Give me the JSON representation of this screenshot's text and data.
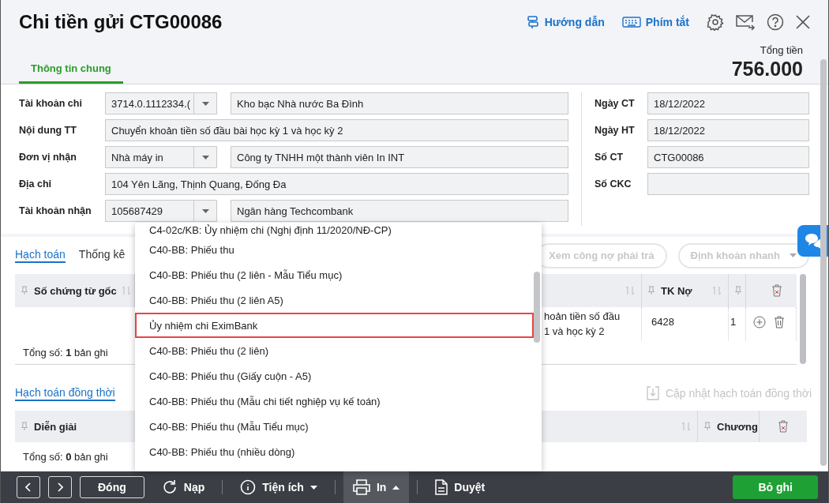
{
  "window": {
    "title": "Chi tiền gửi CTG00086"
  },
  "header_links": [
    {
      "kind": "guide",
      "label": "Hướng dẫn"
    },
    {
      "kind": "shortcut",
      "label": "Phím tắt"
    }
  ],
  "total": {
    "label": "Tổng tiền",
    "value": "756.000"
  },
  "tabs": [
    {
      "label": "Thông tin chung",
      "selected": true
    }
  ],
  "form_left": [
    {
      "label": "Tài khoản chi",
      "kind": "combo",
      "value": "3714.0.1112334.(",
      "extra": "Kho bạc Nhà nước Ba Đình"
    },
    {
      "label": "Nội dung TT",
      "kind": "text",
      "value": "Chuyển khoản tiền số đầu bài học kỳ 1 và học kỳ 2"
    },
    {
      "label": "Đơn vị nhận",
      "kind": "combo",
      "value": "Nhà máy in",
      "extra": "Công ty TNHH một thành viên In INT"
    },
    {
      "label": "Địa chỉ",
      "kind": "text",
      "value": "104 Yên Lãng, Thịnh Quang, Đống Đa"
    },
    {
      "label": "Tài khoản nhận",
      "kind": "combo",
      "value": "105687429",
      "extra": "Ngân hàng Techcombank"
    }
  ],
  "form_right": [
    {
      "label": "Ngày CT",
      "value": "18/12/2022"
    },
    {
      "label": "Ngày HT",
      "value": "18/12/2022"
    },
    {
      "label": "Số CT",
      "value": "CTG00086"
    },
    {
      "label": "Số CKC"
    }
  ],
  "detail_tabs": [
    {
      "label": "Hạch toán",
      "selected": true
    },
    {
      "label": "Thống kê",
      "selected": false
    }
  ],
  "actions": [
    {
      "kind": "button",
      "label": "Xem công nợ phải trả",
      "disabled": true
    },
    {
      "kind": "dropdown",
      "label": "Định khoản nhanh",
      "disabled": true
    }
  ],
  "grid": {
    "columns": [
      {
        "label": "Số chứng từ gốc"
      },
      {
        "label": "TK Nợ"
      }
    ],
    "rows": [
      {
        "description_visible": [
          "hoản tiền số đầu",
          "1 và học kỳ 2"
        ],
        "tk_no": "6428",
        "column_5": "1"
      }
    ],
    "total": "Tổng số: **1** bản ghi"
  },
  "concurrent": {
    "title": "Hạch toán đồng thời",
    "update_action": {
      "label": "Cập nhật hạch toán đồng thời",
      "disabled": true
    },
    "columns": [
      {
        "label": "Diễn giải"
      },
      {
        "label": "Chương"
      }
    ],
    "total": "Tổng số: **0** bản ghi"
  },
  "print_menu": {
    "items": [
      {
        "label": "C4-02c/KB: Ủy nhiệm chi (Nghị định 11/2020/NĐ-CP)",
        "selected": false
      },
      {
        "label": "C40-BB: Phiếu thu",
        "selected": false
      },
      {
        "label": "C40-BB: Phiếu thu (2 liên - Mẫu Tiểu mục)",
        "selected": false
      },
      {
        "label": "C40-BB: Phiếu thu (2 liên A5)",
        "selected": false
      },
      {
        "label": "Ủy nhiệm chi EximBank",
        "selected": true
      },
      {
        "label": "C40-BB: Phiếu thu (2 liên)",
        "selected": false
      },
      {
        "label": "C40-BB: Phiếu thu (Giấy cuộn - A5)",
        "selected": false
      },
      {
        "label": "C40-BB: Phiếu thu (Mẫu chi tiết nghiệp vụ kế toán)",
        "selected": false
      },
      {
        "label": "C40-BB: Phiếu thu (Mẫu Tiểu mục)",
        "selected": false
      },
      {
        "label": "C40-BB: Phiếu thu (nhiều dòng)",
        "selected": false
      }
    ]
  },
  "footer": {
    "buttons": [
      {
        "kind": "prev"
      },
      {
        "kind": "next"
      },
      {
        "kind": "plain",
        "label": "Đóng"
      },
      {
        "kind": "reload",
        "label": "Nạp"
      },
      {
        "kind": "utility",
        "label": "Tiện ích"
      },
      {
        "kind": "print",
        "label": "In",
        "menu_open": true
      },
      {
        "kind": "approve",
        "label": "Duyệt"
      },
      {
        "kind": "save",
        "label": "Bỏ ghi"
      }
    ]
  }
}
